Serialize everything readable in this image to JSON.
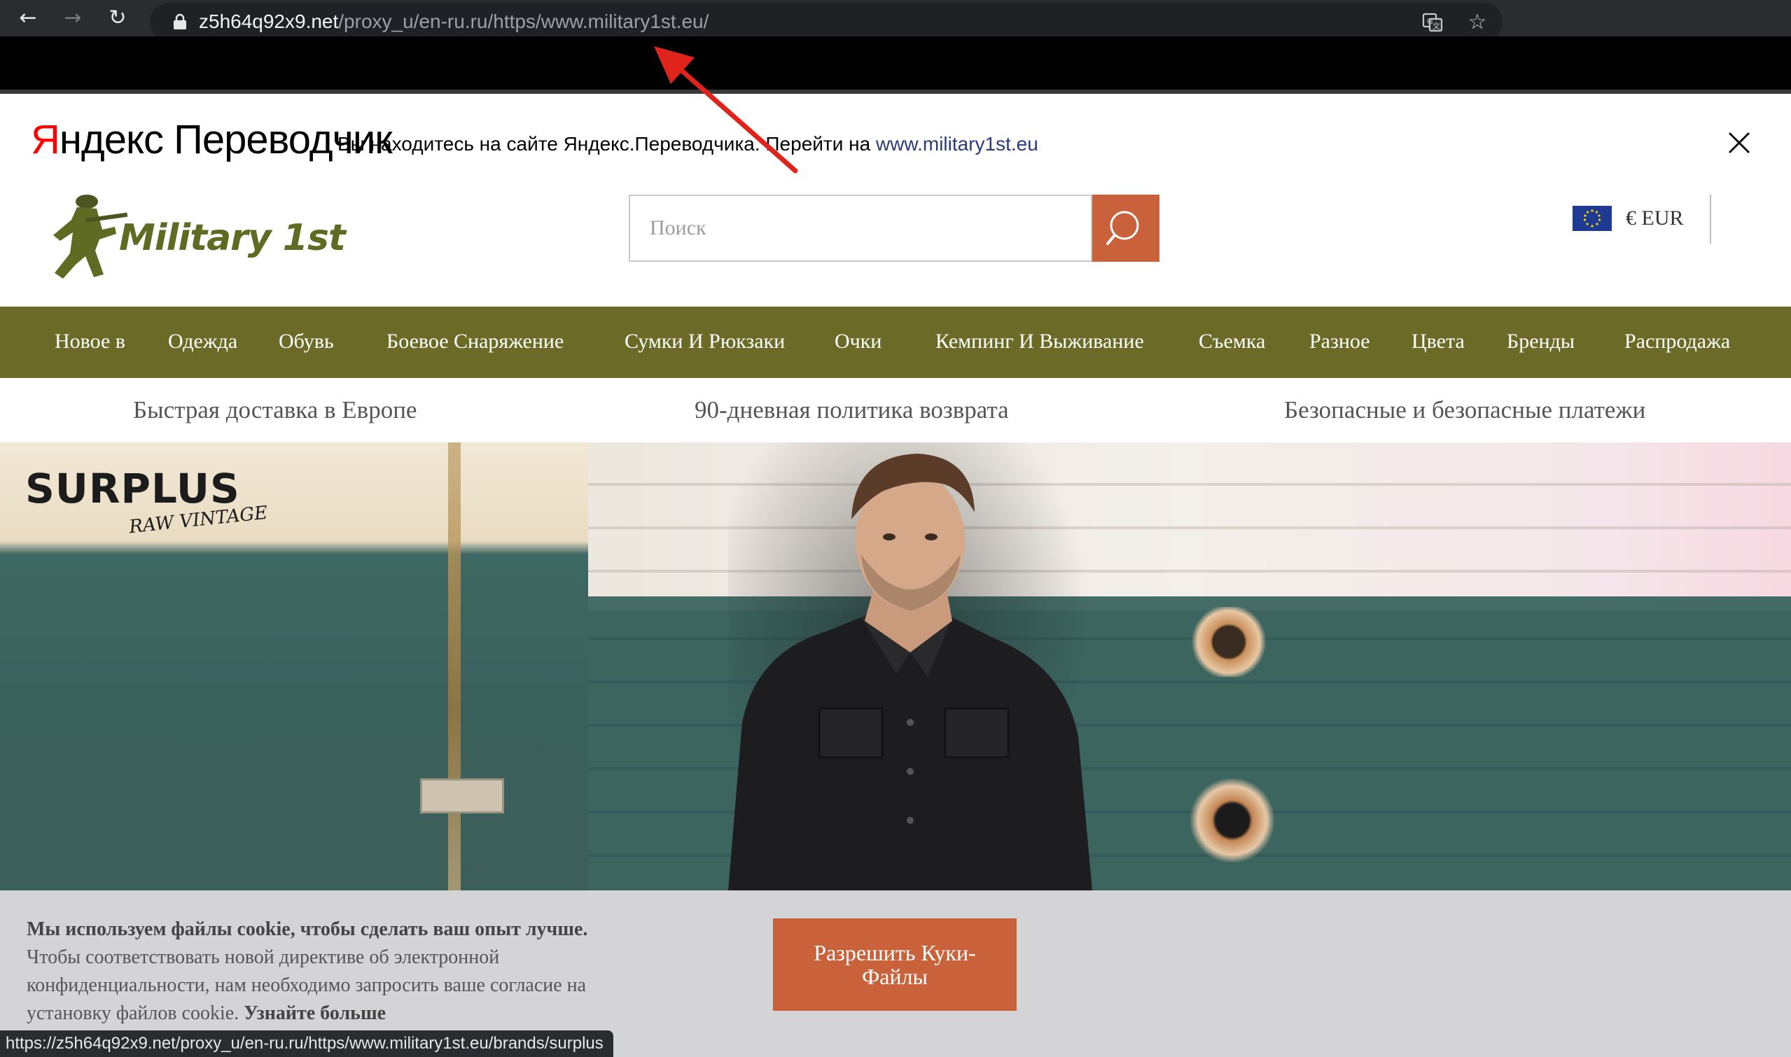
{
  "browser": {
    "url_host": "z5h64q92x9.net",
    "url_path": "/proxy_u/en-ru.ru/https/www.military1st.eu/",
    "status_url": "https://z5h64q92x9.net/proxy_u/en-ru.ru/https/www.military1st.eu/brands/surplus",
    "icons": [
      "back-icon",
      "forward-icon",
      "reload-icon",
      "lock-icon",
      "translate-icon",
      "bookmark-star-icon"
    ]
  },
  "yandex": {
    "logo_red": "Я",
    "logo_rest": "ндекс Переводчик",
    "message": "Вы находитесь на сайте Яндекс.Переводчика. Перейти на ",
    "link": "www.military1st.eu"
  },
  "site": {
    "logo_text": "Military 1st",
    "search_placeholder": "Поиск",
    "currency": "€ EUR",
    "nav": [
      "Новое в",
      "Одежда",
      "Обувь",
      "Боевое Снаряжение",
      "Сумки И Рюкзаки",
      "Очки",
      "Кемпинг И Выживание",
      "Съемка",
      "Разное",
      "Цвета",
      "Бренды",
      "Распродажа"
    ],
    "usp": [
      "Быстрая доставка в Европе",
      "90-дневная политика возврата",
      "Безопасные и безопасные платежи"
    ],
    "hero": {
      "brand": "SURPLUS",
      "brand_sub": "RAW VINTAGE"
    }
  },
  "cookie": {
    "bold": "Мы используем файлы cookie, чтобы сделать ваш опыт лучше.",
    "text": " Чтобы соответствовать новой директиве об электронной конфиденциальности, нам необходимо запросить ваше согласие на установку файлов cookie. ",
    "learn_more": "Узнайте больше",
    "button": "Разрешить Куки-Файлы"
  },
  "colors": {
    "nav_bg": "#6b6b27",
    "accent": "#c9613a",
    "cookie_bg": "#d4d4d6",
    "arrow": "#e0241b"
  }
}
